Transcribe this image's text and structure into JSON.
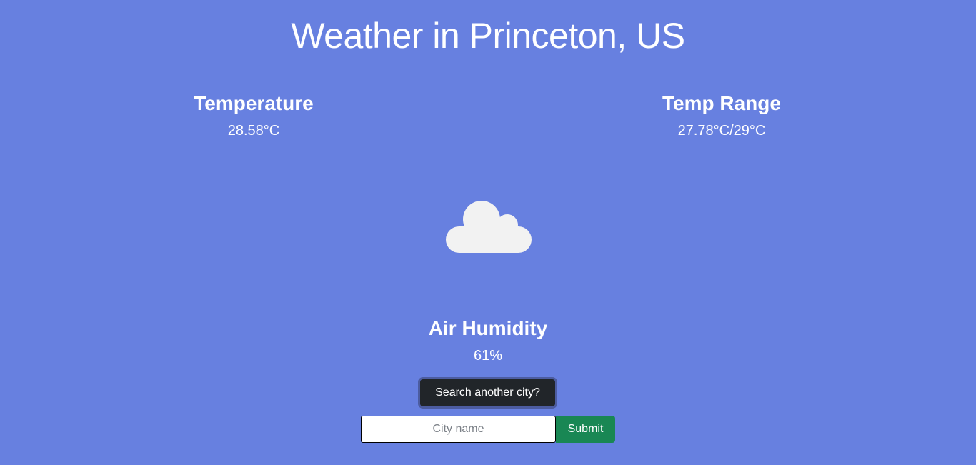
{
  "header": {
    "title": "Weather in Princeton, US"
  },
  "stats": {
    "temperature": {
      "label": "Temperature",
      "value": "28.58°C"
    },
    "temp_range": {
      "label": "Temp Range",
      "value": "27.78°C/29°C"
    },
    "humidity": {
      "label": "Air Humidity",
      "value": "61%"
    }
  },
  "weather_icon": {
    "name": "cloud-icon",
    "color": "#f2f2f2"
  },
  "search": {
    "toggle_label": "Search another city?",
    "input_value": "",
    "placeholder": "City name",
    "submit_label": "Submit"
  },
  "colors": {
    "background": "#6780e0",
    "search_button": "#212529",
    "submit_button": "#198754"
  }
}
